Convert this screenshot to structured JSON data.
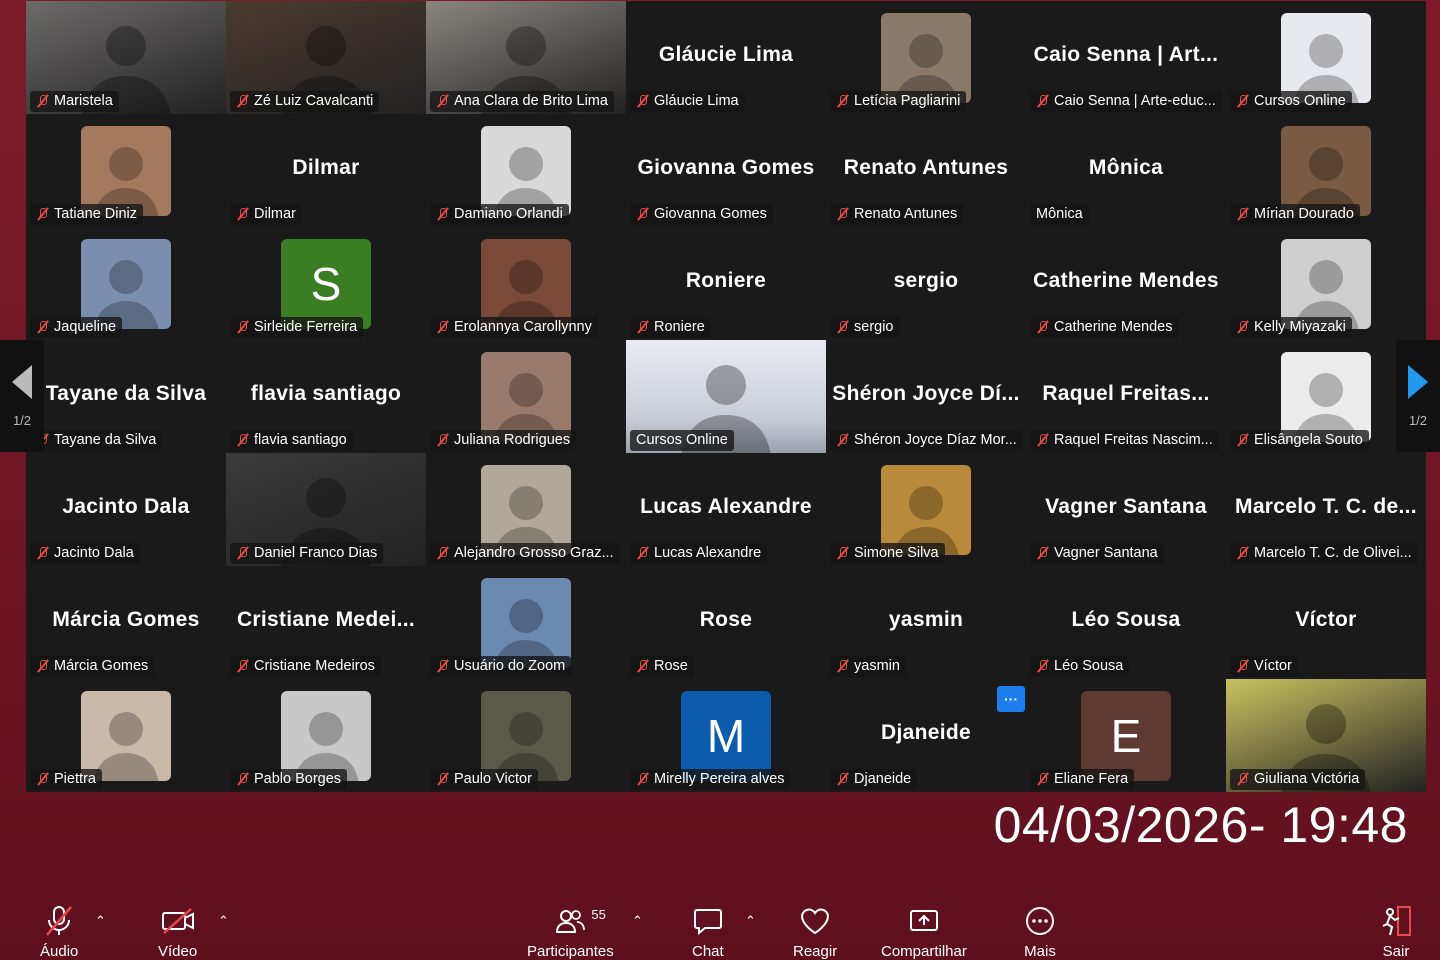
{
  "timestamp": "04/03/2026- 19:48",
  "pagination": {
    "left": "1/2",
    "right": "1/2"
  },
  "participants": [
    {
      "label": "Maristela",
      "big": "",
      "kind": "video",
      "color": "#6d6a6a"
    },
    {
      "label": "Zé Luiz Cavalcanti",
      "big": "",
      "kind": "video",
      "color": "#4a3a30"
    },
    {
      "label": "Ana Clara de Brito Lima",
      "big": "",
      "kind": "video",
      "color": "#8a8580"
    },
    {
      "label": "Gláucie Lima",
      "big": "Gláucie Lima",
      "kind": "name"
    },
    {
      "label": "Letícia Pagliarini",
      "big": "",
      "kind": "avatar",
      "color": "#8a7a6a"
    },
    {
      "label": "Caio Senna | Arte-educ...",
      "big": "Caio Senna | Art...",
      "kind": "name"
    },
    {
      "label": "Cursos Online",
      "big": "",
      "kind": "avatar",
      "color": "#e8e8ef"
    },
    {
      "label": "Tatiane Diniz",
      "big": "",
      "kind": "avatar",
      "color": "#a47a5e"
    },
    {
      "label": "Dilmar",
      "big": "Dilmar",
      "kind": "name"
    },
    {
      "label": "Damiano Orlandi",
      "big": "",
      "kind": "avatar",
      "color": "#d9d9d9"
    },
    {
      "label": "Giovanna Gomes",
      "big": "Giovanna Gomes",
      "kind": "name"
    },
    {
      "label": "Renato Antunes",
      "big": "Renato Antunes",
      "kind": "name"
    },
    {
      "label": "Mônica",
      "big": "Mônica",
      "kind": "name",
      "nomute": true
    },
    {
      "label": "Mírian Dourado",
      "big": "",
      "kind": "avatar",
      "color": "#7a5a42"
    },
    {
      "label": "Jaqueline",
      "big": "",
      "kind": "avatar",
      "color": "#7a8fb0"
    },
    {
      "label": "Sirleide Ferreira",
      "big": "",
      "kind": "letter",
      "letter": "S",
      "color": "#3a7d23"
    },
    {
      "label": "Erolannya Carollynny",
      "big": "",
      "kind": "avatar",
      "color": "#7a4a38"
    },
    {
      "label": "Roniere",
      "big": "Roniere",
      "kind": "name"
    },
    {
      "label": "sergio",
      "big": "sergio",
      "kind": "name"
    },
    {
      "label": "Catherine Mendes",
      "big": "Catherine Mendes",
      "kind": "name"
    },
    {
      "label": "Kelly Miyazaki",
      "big": "",
      "kind": "avatar",
      "color": "#cfcfcf"
    },
    {
      "label": "Tayane da Silva",
      "big": "Tayane da Silva",
      "kind": "name"
    },
    {
      "label": "flavia santiago",
      "big": "flavia santiago",
      "kind": "name"
    },
    {
      "label": "Juliana Rodrigues",
      "big": "",
      "kind": "avatar",
      "color": "#9a7a6a"
    },
    {
      "label": "Cursos Online",
      "big": "",
      "kind": "screen",
      "color": "#c8ccd6",
      "active": true,
      "nomute": true
    },
    {
      "label": "Shéron Joyce Díaz Mor...",
      "big": "Shéron Joyce Dí...",
      "kind": "name"
    },
    {
      "label": "Raquel Freitas Nascim...",
      "big": "Raquel  Freitas...",
      "kind": "name"
    },
    {
      "label": "Elisângela Souto",
      "big": "",
      "kind": "avatar",
      "color": "#ececec"
    },
    {
      "label": "Jacinto Dala",
      "big": "Jacinto Dala",
      "kind": "name"
    },
    {
      "label": "Daniel Franco Dias",
      "big": "",
      "kind": "video",
      "color": "#3a3a3a"
    },
    {
      "label": "Alejandro Grosso Graz...",
      "big": "",
      "kind": "avatar",
      "color": "#b0a89a"
    },
    {
      "label": "Lucas Alexandre",
      "big": "Lucas Alexandre",
      "kind": "name"
    },
    {
      "label": "Simone Silva",
      "big": "",
      "kind": "avatar",
      "color": "#b88a3a"
    },
    {
      "label": "Vagner Santana",
      "big": "Vagner Santana",
      "kind": "name"
    },
    {
      "label": "Marcelo T. C. de Olivei...",
      "big": "Marcelo  T. C. de...",
      "kind": "name"
    },
    {
      "label": "Márcia Gomes",
      "big": "Márcia Gomes",
      "kind": "name"
    },
    {
      "label": "Cristiane Medeiros",
      "big": "Cristiane  Medei...",
      "kind": "name"
    },
    {
      "label": "Usuário do Zoom",
      "big": "",
      "kind": "avatar",
      "color": "#6a8ab0"
    },
    {
      "label": "Rose",
      "big": "Rose",
      "kind": "name"
    },
    {
      "label": "yasmin",
      "big": "yasmin",
      "kind": "name"
    },
    {
      "label": "Léo Sousa",
      "big": "Léo Sousa",
      "kind": "name"
    },
    {
      "label": "Víctor",
      "big": "Víctor",
      "kind": "name"
    },
    {
      "label": "Piettra",
      "big": "",
      "kind": "avatar",
      "color": "#c9b9a9"
    },
    {
      "label": "Pablo Borges",
      "big": "",
      "kind": "avatar",
      "color": "#c8c8c8"
    },
    {
      "label": "Paulo Victor",
      "big": "",
      "kind": "avatar",
      "color": "#5a5a4a"
    },
    {
      "label": "Mirelly Pereira alves",
      "big": "",
      "kind": "letter",
      "letter": "M",
      "color": "#0b5cad"
    },
    {
      "label": "Djaneide",
      "big": "Djaneide",
      "kind": "name"
    },
    {
      "label": "Eliane Fera",
      "big": "",
      "kind": "letter",
      "letter": "E",
      "color": "#5e3a30"
    },
    {
      "label": "Giuliana Victória",
      "big": "",
      "kind": "video",
      "color": "#c9c260"
    }
  ],
  "toolbar": {
    "audio": "Áudio",
    "video": "Vídeo",
    "participants": "Participantes",
    "participants_count": "55",
    "chat": "Chat",
    "react": "Reagir",
    "share": "Compartilhar",
    "more": "Mais",
    "leave": "Sair"
  }
}
